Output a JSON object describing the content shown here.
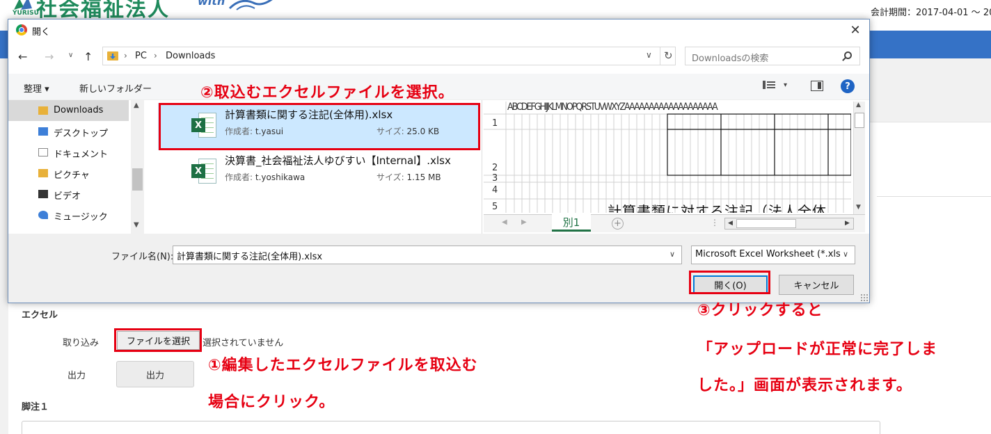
{
  "page": {
    "logo_text": "社会福祉法人",
    "logo_sub": "YURISU",
    "logo_with": "with",
    "fiscal_period": "会計期間：2017-04-01 ～ 20",
    "excel_section": "エクセル",
    "import_label": "取り込み",
    "file_button": "ファイルを選択",
    "no_file_text": "選択されていません",
    "output_label": "出力",
    "output_button": "出力",
    "footnote_label": "脚注１"
  },
  "dialog": {
    "title": "開く",
    "close_glyph": "✕",
    "address": {
      "segments": [
        "PC",
        "Downloads"
      ]
    },
    "search_placeholder": "Downloadsの検索",
    "toolbar": {
      "organize": "整理 ▾",
      "new_folder": "新しいフォルダー",
      "help": "?"
    },
    "nav_items": [
      {
        "label": "Downloads",
        "icon": "downloads-icon",
        "selected": true
      },
      {
        "label": "デスクトップ",
        "icon": "desktop-icon"
      },
      {
        "label": "ドキュメント",
        "icon": "documents-icon"
      },
      {
        "label": "ピクチャ",
        "icon": "pictures-icon"
      },
      {
        "label": "ビデオ",
        "icon": "videos-icon"
      },
      {
        "label": "ミュージック",
        "icon": "music-icon"
      }
    ],
    "files": [
      {
        "name": "計算書類に関する注記(全体用).xlsx",
        "author_label": "作成者:",
        "author": "t.yasui",
        "size_label": "サイズ:",
        "size": "25.0 KB",
        "selected": true
      },
      {
        "name": "決算書_社会福祉法人ゆびすい【Internal】.xlsx",
        "author_label": "作成者:",
        "author": "t.yoshikawa",
        "size_label": "サイズ:",
        "size": "1.15 MB",
        "selected": false
      }
    ],
    "preview": {
      "column_header": "ABCDEFGHIJKLMNOPQRSTUVWXYZAAAAAAAAAAAAAAAAAAA",
      "row_numbers": [
        "1",
        "2",
        "3",
        "4",
        "5"
      ],
      "title_text": "計算書類に対する注記（法人全体",
      "sheet_tab": "別1"
    },
    "file_name_label": "ファイル名(N):",
    "file_name_value": "計算書類に関する注記(全体用).xlsx",
    "file_type_value": "Microsoft Excel Worksheet (*.xlsx)",
    "open_button": "開く(O)",
    "cancel_button": "キャンセル"
  },
  "annotations": {
    "step2": "②取込むエクセルファイルを選択。",
    "step1_line1": "①編集したエクセルファイルを取込む",
    "step1_line2": "場合にクリック。",
    "step3_line1": "③クリックすると",
    "step3_line2": "「アップロードが正常に完了しま",
    "step3_line3": "した。」画面が表示されます。"
  },
  "colors": {
    "annotation_red": "#e60012",
    "nav_blue": "#3572c6",
    "logo_green": "#1f8a5c",
    "excel_green": "#217346",
    "selection_blue": "#cce8ff"
  }
}
